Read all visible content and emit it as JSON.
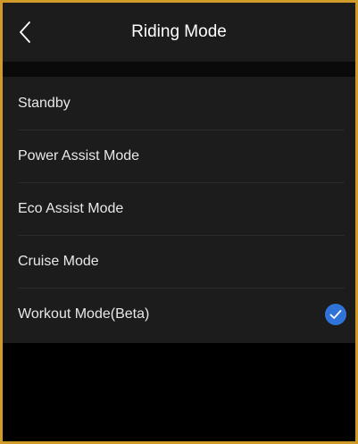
{
  "header": {
    "title": "Riding Mode",
    "back_icon": "chevron-left-icon"
  },
  "modes": [
    {
      "label": "Standby",
      "selected": false
    },
    {
      "label": "Power Assist Mode",
      "selected": false
    },
    {
      "label": "Eco Assist Mode",
      "selected": false
    },
    {
      "label": "Cruise Mode",
      "selected": false
    },
    {
      "label": "Workout Mode(Beta)",
      "selected": true
    }
  ],
  "colors": {
    "border": "#d19b2a",
    "panel": "#1c1c1c",
    "background": "#000000",
    "accent": "#2f73d8"
  },
  "selected_icon": "checkmark-circle-icon"
}
